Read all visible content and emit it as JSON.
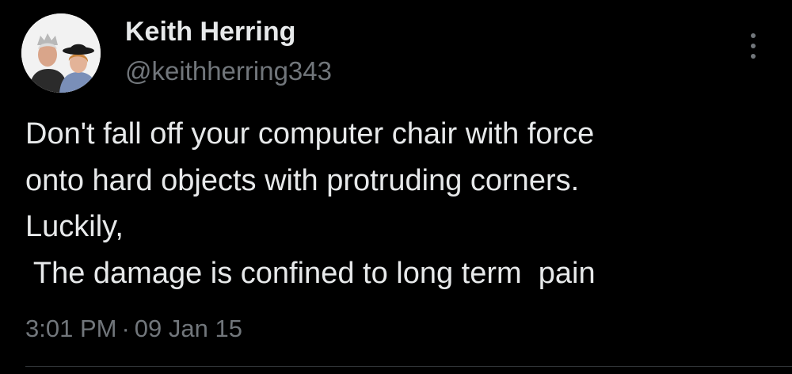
{
  "tweet": {
    "author": {
      "avatar_icon": "profile-photo-avatar",
      "name": "Keith Herring",
      "handle": "@keithherring343"
    },
    "more_icon": "more-vertical-icon",
    "text_lines": [
      "Don't fall off your computer chair with force",
      "onto hard objects with protruding corners.",
      "Luckily,",
      " The damage is confined to long term  pain"
    ],
    "time": "3:01 PM",
    "separator": "·",
    "date": "09 Jan 15"
  },
  "colors": {
    "background": "#000000",
    "primary_text": "#e7e9ea",
    "secondary_text": "#71767b",
    "divider": "#2f3336"
  }
}
